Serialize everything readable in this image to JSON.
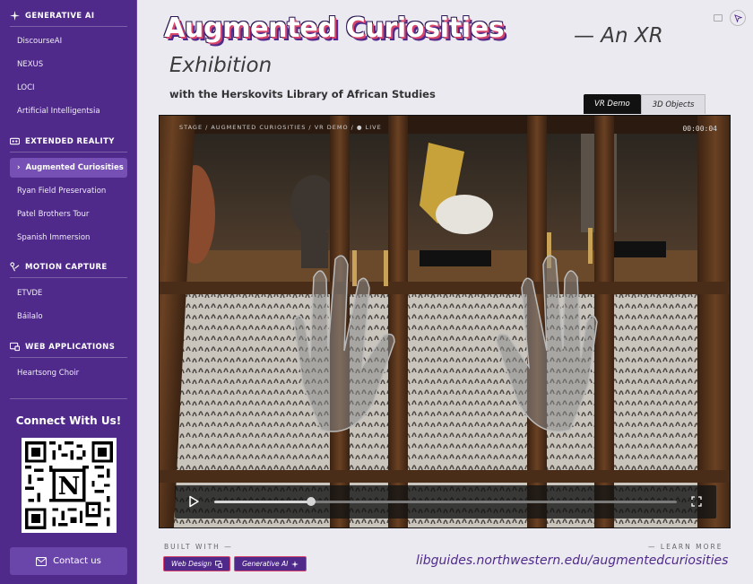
{
  "sidebar": {
    "sections": [
      {
        "title": "Generative AI",
        "icon": "sparkle-icon",
        "items": [
          "DiscourseAI",
          "NEXUS",
          "LOCI",
          "Artificial Intelligentsia"
        ]
      },
      {
        "title": "Extended Reality",
        "icon": "headset-icon",
        "items": [
          "Augmented Curiosities",
          "Ryan Field Preservation",
          "Patel Brothers Tour",
          "Spanish Immersion"
        ]
      },
      {
        "title": "Motion Capture",
        "icon": "motion-icon",
        "items": [
          "ETVDE",
          "Báilalo"
        ]
      },
      {
        "title": "Web Applications",
        "icon": "browser-icon",
        "items": [
          "Heartsong Choir"
        ]
      }
    ],
    "active_item": "Augmented Curiosities",
    "connect_title": "Connect With Us!",
    "contact_label": "Contact us"
  },
  "header": {
    "title": "Augmented Curiosities",
    "title_suffix_1": "— An XR",
    "title_suffix_2": "Exhibition",
    "subtitle": "with the Herskovits Library of African Studies"
  },
  "tabs": [
    {
      "label": "VR Demo",
      "active": true
    },
    {
      "label": "3D Objects",
      "active": false
    }
  ],
  "video": {
    "hud_text": "Stage  /  Augmented Curiosities  /  VR Demo  /  ● Live",
    "timecode": "00:00:04",
    "progress": 0.21
  },
  "footer": {
    "built_with_label": "BUILT WITH —",
    "chips": [
      "Web Design",
      "Generative AI"
    ],
    "learn_more_label": "— LEARN MORE",
    "url": "libguides.northwestern.edu/augmentedcuriosities"
  },
  "colors": {
    "sidebar_bg": "#4f2a8a",
    "accent_pink": "#d8456b",
    "link_purple": "#4f2a8a"
  }
}
